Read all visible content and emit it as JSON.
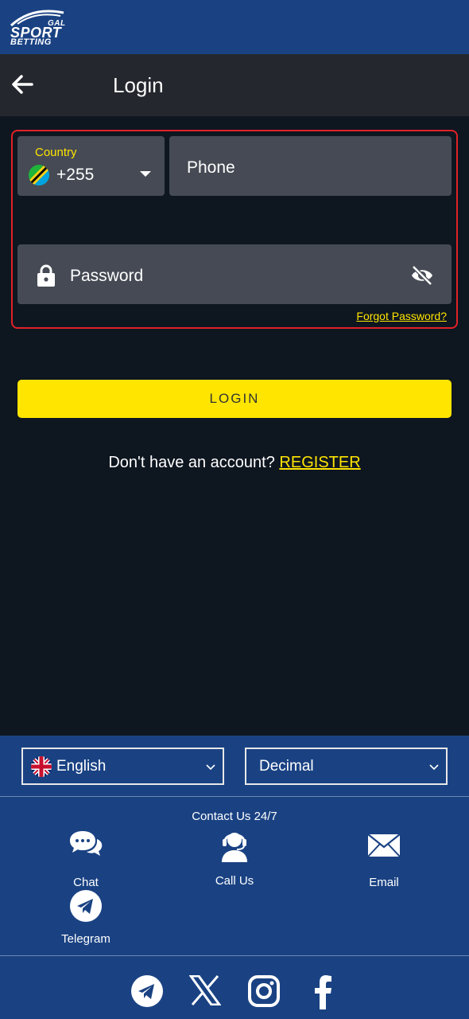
{
  "brand": {
    "line1": "GAL",
    "line2": "SPORT",
    "line3": "BETTING"
  },
  "header": {
    "title": "Login",
    "back_icon": "arrow-left-icon"
  },
  "form": {
    "country_label": "Country",
    "country_code": "+255",
    "country_flag": "tanzania-flag-icon",
    "phone_placeholder": "Phone",
    "password_placeholder": "Password",
    "forgot_password": "Forgot Password?",
    "login_button": "LOGIN"
  },
  "register": {
    "prompt": "Don't have an account?",
    "link": "REGISTER"
  },
  "footer": {
    "language": "English",
    "odds_format": "Decimal",
    "contact_title": "Contact Us 24/7",
    "contacts": [
      {
        "label": "Chat",
        "icon": "chat-bubbles-icon"
      },
      {
        "label": "Call Us",
        "icon": "headset-agent-icon"
      },
      {
        "label": "Email",
        "icon": "envelope-icon"
      },
      {
        "label": "Telegram",
        "icon": "telegram-icon"
      }
    ],
    "socials": [
      "telegram-icon",
      "x-icon",
      "instagram-icon",
      "facebook-icon"
    ]
  },
  "colors": {
    "brand_blue": "#1a4283",
    "accent_yellow": "#ffe500",
    "highlight_red": "#e02227",
    "field_gray": "#464a54",
    "background": "#0e1620"
  }
}
